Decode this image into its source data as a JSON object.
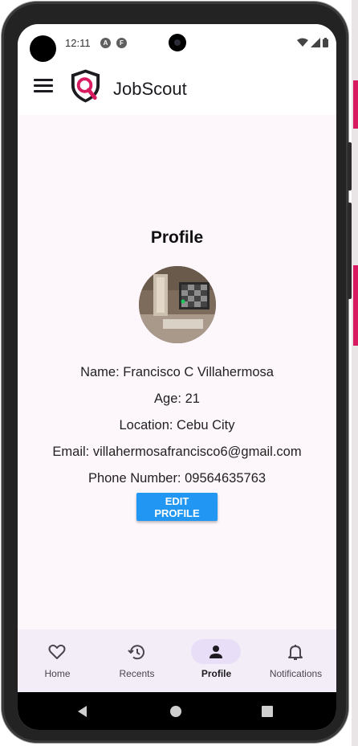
{
  "status_bar": {
    "time": "12:11",
    "notif_icons": [
      "A",
      "F"
    ]
  },
  "app_bar": {
    "title": "JobScout"
  },
  "profile": {
    "heading": "Profile",
    "name_line": "Name: Francisco C Villahermosa",
    "age_line": "Age: 21",
    "location_line": "Location: Cebu City",
    "email_line": "Email: villahermosafrancisco6@gmail.com",
    "phone_line": "Phone Number: 09564635763",
    "edit_button": "EDIT PROFILE"
  },
  "bottom_nav": {
    "items": [
      {
        "label": "Home",
        "icon": "heart-icon"
      },
      {
        "label": "Recents",
        "icon": "history-icon"
      },
      {
        "label": "Profile",
        "icon": "person-icon",
        "active": true
      },
      {
        "label": "Notifications",
        "icon": "bell-icon"
      }
    ]
  },
  "colors": {
    "accent": "#2196f3",
    "brand": "#d81b60",
    "nav_active_pill": "#e8def8",
    "background": "#fdf7fb"
  }
}
